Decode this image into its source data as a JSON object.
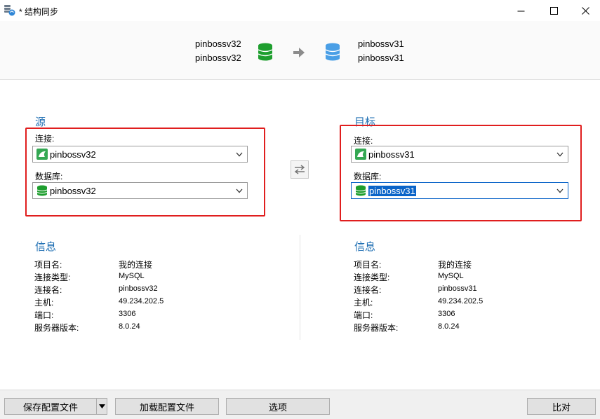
{
  "window": {
    "title": "* 结构同步",
    "minimize_label": "—",
    "maximize_label": "☐",
    "close_label": "✕"
  },
  "header": {
    "source_connection": "pinbossv32",
    "source_database": "pinbossv32",
    "target_connection": "pinbossv31",
    "target_database": "pinbossv31",
    "source_db_color": "#1e9e2e",
    "target_db_color": "#4a9fe6",
    "arrow_icon": "arrow-right-icon"
  },
  "source": {
    "heading": "源",
    "connection_label": "连接:",
    "connection_value": "pinbossv32",
    "database_label": "数据库:",
    "database_value": "pinbossv32"
  },
  "target": {
    "heading": "目标",
    "connection_label": "连接:",
    "connection_value": "pinbossv31",
    "database_label": "数据库:",
    "database_value": "pinbossv31"
  },
  "source_info": {
    "heading": "信息",
    "rows": [
      {
        "label": "项目名:",
        "value": "我的连接"
      },
      {
        "label": "连接类型:",
        "value": "MySQL"
      },
      {
        "label": "连接名:",
        "value": "pinbossv32"
      },
      {
        "label": "主机:",
        "value": "49.234.202.5"
      },
      {
        "label": "端口:",
        "value": "3306"
      },
      {
        "label": "服务器版本:",
        "value": "8.0.24"
      }
    ]
  },
  "target_info": {
    "heading": "信息",
    "rows": [
      {
        "label": "项目名:",
        "value": "我的连接"
      },
      {
        "label": "连接类型:",
        "value": "MySQL"
      },
      {
        "label": "连接名:",
        "value": "pinbossv31"
      },
      {
        "label": "主机:",
        "value": "49.234.202.5"
      },
      {
        "label": "端口:",
        "value": "3306"
      },
      {
        "label": "服务器版本:",
        "value": "8.0.24"
      }
    ]
  },
  "footer": {
    "save_profile": "保存配置文件",
    "load_profile": "加载配置文件",
    "options": "选项",
    "compare": "比对"
  },
  "colors": {
    "highlight_box": "#e01e1e",
    "heading": "#1f6fb3",
    "selection": "#0a64c8"
  }
}
